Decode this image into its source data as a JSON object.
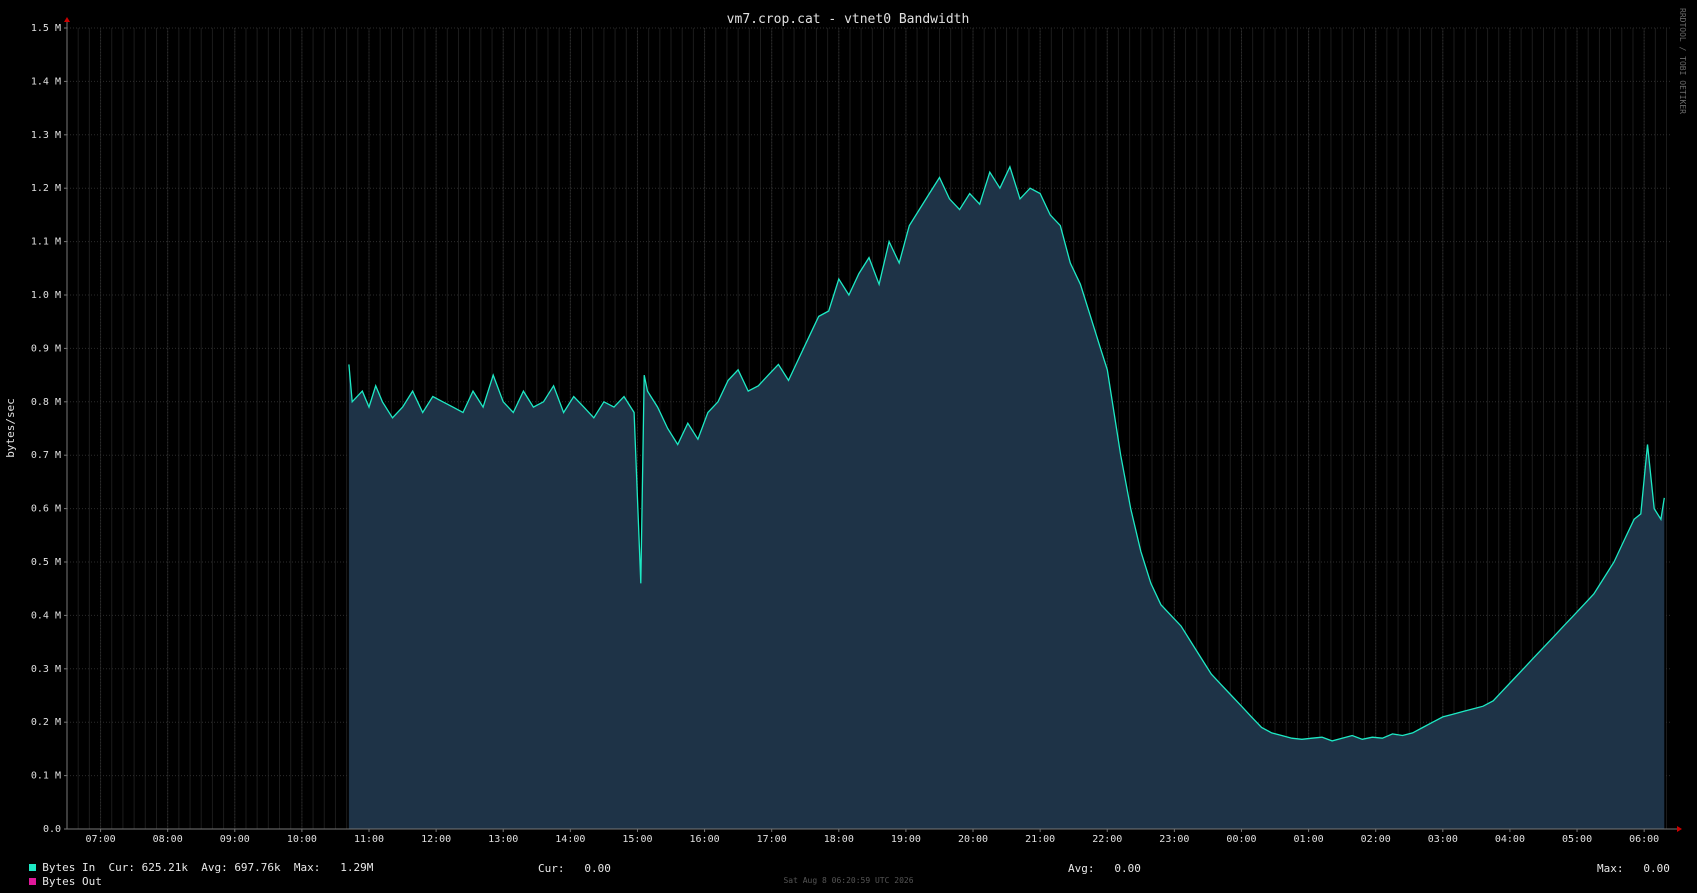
{
  "chart_data": {
    "type": "area",
    "title": "vm7.crop.cat - vtnet0 Bandwidth",
    "ylabel": "bytes/sec",
    "xlabel": "",
    "ylim": [
      0,
      1500000
    ],
    "yticks": [
      {
        "value": 0,
        "label": "0.0"
      },
      {
        "value": 100000,
        "label": "0.1 M"
      },
      {
        "value": 200000,
        "label": "0.2 M"
      },
      {
        "value": 300000,
        "label": "0.3 M"
      },
      {
        "value": 400000,
        "label": "0.4 M"
      },
      {
        "value": 500000,
        "label": "0.5 M"
      },
      {
        "value": 600000,
        "label": "0.6 M"
      },
      {
        "value": 700000,
        "label": "0.7 M"
      },
      {
        "value": 800000,
        "label": "0.8 M"
      },
      {
        "value": 900000,
        "label": "0.9 M"
      },
      {
        "value": 1000000,
        "label": "1.0 M"
      },
      {
        "value": 1100000,
        "label": "1.1 M"
      },
      {
        "value": 1200000,
        "label": "1.2 M"
      },
      {
        "value": 1300000,
        "label": "1.3 M"
      },
      {
        "value": 1400000,
        "label": "1.4 M"
      },
      {
        "value": 1500000,
        "label": "1.5 M"
      }
    ],
    "xlim_hours": [
      6.5,
      30.4
    ],
    "xticks": [
      {
        "hour": 7,
        "label": "07:00"
      },
      {
        "hour": 8,
        "label": "08:00"
      },
      {
        "hour": 9,
        "label": "09:00"
      },
      {
        "hour": 10,
        "label": "10:00"
      },
      {
        "hour": 11,
        "label": "11:00"
      },
      {
        "hour": 12,
        "label": "12:00"
      },
      {
        "hour": 13,
        "label": "13:00"
      },
      {
        "hour": 14,
        "label": "14:00"
      },
      {
        "hour": 15,
        "label": "15:00"
      },
      {
        "hour": 16,
        "label": "16:00"
      },
      {
        "hour": 17,
        "label": "17:00"
      },
      {
        "hour": 18,
        "label": "18:00"
      },
      {
        "hour": 19,
        "label": "19:00"
      },
      {
        "hour": 20,
        "label": "20:00"
      },
      {
        "hour": 21,
        "label": "21:00"
      },
      {
        "hour": 22,
        "label": "22:00"
      },
      {
        "hour": 23,
        "label": "23:00"
      },
      {
        "hour": 24,
        "label": "00:00"
      },
      {
        "hour": 25,
        "label": "01:00"
      },
      {
        "hour": 26,
        "label": "02:00"
      },
      {
        "hour": 27,
        "label": "03:00"
      },
      {
        "hour": 28,
        "label": "04:00"
      },
      {
        "hour": 29,
        "label": "05:00"
      },
      {
        "hour": 30,
        "label": "06:00"
      }
    ],
    "grid": true,
    "series": [
      {
        "name": "Bytes In",
        "color": "#1de9c4",
        "fill": "#1e3347",
        "x_hours": [
          10.7,
          10.75,
          10.9,
          11.0,
          11.1,
          11.2,
          11.35,
          11.5,
          11.65,
          11.8,
          11.95,
          12.1,
          12.25,
          12.4,
          12.55,
          12.7,
          12.85,
          13.0,
          13.15,
          13.3,
          13.45,
          13.6,
          13.75,
          13.9,
          14.05,
          14.2,
          14.35,
          14.5,
          14.65,
          14.8,
          14.95,
          15.05,
          15.1,
          15.15,
          15.3,
          15.45,
          15.6,
          15.75,
          15.9,
          16.05,
          16.2,
          16.35,
          16.5,
          16.65,
          16.8,
          16.95,
          17.1,
          17.25,
          17.4,
          17.55,
          17.7,
          17.85,
          18.0,
          18.15,
          18.3,
          18.45,
          18.6,
          18.75,
          18.9,
          19.05,
          19.2,
          19.35,
          19.5,
          19.65,
          19.8,
          19.95,
          20.1,
          20.25,
          20.4,
          20.55,
          20.7,
          20.85,
          21.0,
          21.15,
          21.3,
          21.45,
          21.6,
          21.75,
          21.9,
          22.0,
          22.1,
          22.2,
          22.35,
          22.5,
          22.65,
          22.8,
          22.95,
          23.1,
          23.25,
          23.4,
          23.55,
          23.7,
          23.85,
          24.0,
          24.15,
          24.3,
          24.45,
          24.6,
          24.75,
          24.9,
          25.05,
          25.2,
          25.35,
          25.5,
          25.65,
          25.8,
          25.95,
          26.1,
          26.25,
          26.4,
          26.55,
          26.7,
          26.85,
          27.0,
          27.15,
          27.3,
          27.45,
          27.6,
          27.75,
          27.9,
          28.05,
          28.2,
          28.35,
          28.5,
          28.65,
          28.8,
          28.95,
          29.1,
          29.25,
          29.4,
          29.55,
          29.7,
          29.85,
          29.95,
          30.05,
          30.15,
          30.25,
          30.3
        ],
        "values": [
          870000,
          800000,
          820000,
          790000,
          830000,
          800000,
          770000,
          790000,
          820000,
          780000,
          810000,
          800000,
          790000,
          780000,
          820000,
          790000,
          850000,
          800000,
          780000,
          820000,
          790000,
          800000,
          830000,
          780000,
          810000,
          790000,
          770000,
          800000,
          790000,
          810000,
          780000,
          460000,
          850000,
          820000,
          790000,
          750000,
          720000,
          760000,
          730000,
          780000,
          800000,
          840000,
          860000,
          820000,
          830000,
          850000,
          870000,
          840000,
          880000,
          920000,
          960000,
          970000,
          1030000,
          1000000,
          1040000,
          1070000,
          1020000,
          1100000,
          1060000,
          1130000,
          1160000,
          1190000,
          1220000,
          1180000,
          1160000,
          1190000,
          1170000,
          1230000,
          1200000,
          1240000,
          1180000,
          1200000,
          1190000,
          1150000,
          1130000,
          1060000,
          1020000,
          960000,
          900000,
          860000,
          780000,
          700000,
          600000,
          520000,
          460000,
          420000,
          400000,
          380000,
          350000,
          320000,
          290000,
          270000,
          250000,
          230000,
          210000,
          190000,
          180000,
          175000,
          170000,
          168000,
          170000,
          172000,
          165000,
          170000,
          175000,
          168000,
          172000,
          170000,
          178000,
          175000,
          180000,
          190000,
          200000,
          210000,
          215000,
          220000,
          225000,
          230000,
          240000,
          260000,
          280000,
          300000,
          320000,
          340000,
          360000,
          380000,
          400000,
          420000,
          440000,
          470000,
          500000,
          540000,
          580000,
          590000,
          720000,
          600000,
          580000,
          620000
        ]
      },
      {
        "name": "Bytes Out",
        "color": "#e0189a",
        "x_hours": [
          10.7,
          30.3
        ],
        "values": [
          0,
          0
        ]
      }
    ]
  },
  "legend": {
    "in_name": "Bytes In",
    "in_stats": "Cur: 625.21k  Avg: 697.76k  Max:   1.29M",
    "out_name": "Bytes Out",
    "out_cur": "Cur:   0.00",
    "out_avg": "Avg:   0.00",
    "out_max": "Max:   0.00"
  },
  "timestamp": "Sat Aug  8 06:20:59 UTC 2026",
  "watermark": "RRDTOOL / TOBI OETIKER"
}
